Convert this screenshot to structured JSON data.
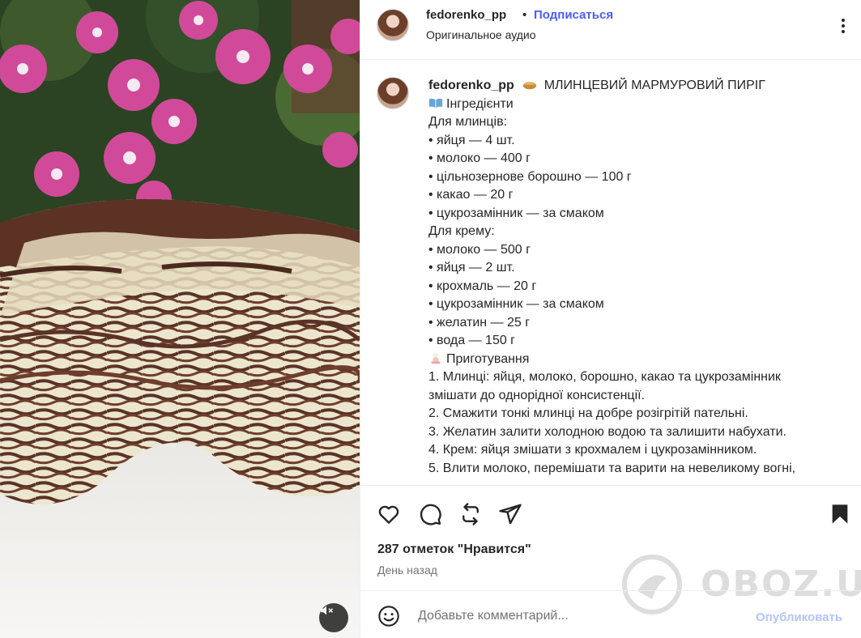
{
  "post": {
    "username": "fedorenko_pp",
    "separator": "•",
    "follow_label": "Подписаться",
    "audio_label": "Оригинальное аудио"
  },
  "caption": {
    "username": "fedorenko_pp",
    "title": "МЛИНЦЕВИЙ МАРМУРОВИЙ ПИРІГ",
    "lines": [
      "Інгредієнти",
      "Для млинців:",
      "• яйця — 4 шт.",
      "• молоко — 400 г",
      "• цільнозернове борошно — 100 г",
      "• какао — 20 г",
      "• цукрозамінник — за смаком",
      "Для крему:",
      "• молоко — 500 г",
      "• яйця — 2 шт.",
      "• крохмаль — 20 г",
      "• цукрозамінник — за смаком",
      "• желатин — 25 г",
      "• вода — 150 г",
      "Приготування",
      "1. Млинці: яйця, молоко, борошно, какао та цукрозамінник",
      "змішати до однорідної консистенції.",
      "2. Смажити тонкі млинці на добре розігрітій пательні.",
      "3. Желатин залити холодною водою та залишити набухати.",
      "4. Крем: яйця змішати з крохмалем і цукрозамінником.",
      "5. Влити молоко, перемішати та варити на невеликому вогні,"
    ]
  },
  "stats": {
    "likes": "287 отметок \"Нравится\"",
    "time": "День назад"
  },
  "comment": {
    "placeholder": "Добавьте комментарий...",
    "publish_label": "Опубликовать"
  },
  "watermark": {
    "text": "OBOZ.UA"
  },
  "icons": {
    "like": "heart-icon",
    "comment": "comment-icon",
    "repost": "repost-icon",
    "share": "share-icon",
    "save": "bookmark-icon",
    "more": "more-icon",
    "mute": "volume-muted-icon",
    "emoji": "emoji-icon"
  },
  "colors": {
    "accent": "#4a5df9",
    "publish_disabled": "#b3c4fb",
    "text": "#262626",
    "muted": "#737373"
  }
}
